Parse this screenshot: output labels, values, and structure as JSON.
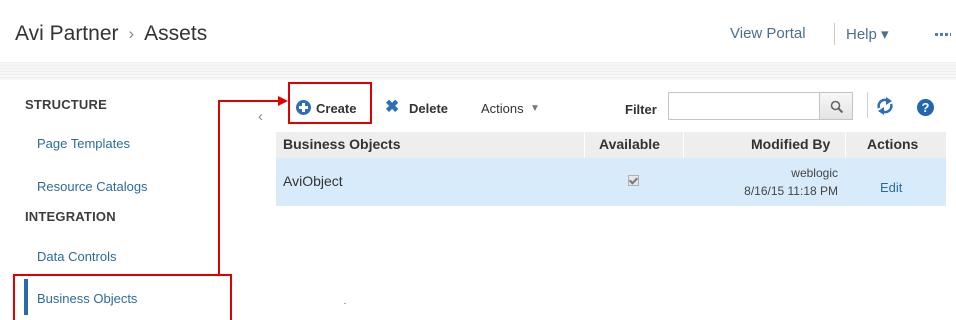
{
  "header": {
    "breadcrumb": {
      "parent": "Avi Partner",
      "separator": "›",
      "current": "Assets"
    },
    "view_portal": "View Portal",
    "help": "Help ▾"
  },
  "sidebar": {
    "sections": [
      {
        "heading": "STRUCTURE",
        "items": [
          "Page Templates",
          "Resource Catalogs"
        ]
      },
      {
        "heading": "INTEGRATION",
        "items": [
          "Data Controls",
          "Business Objects"
        ]
      }
    ],
    "selected_item": "Business Objects"
  },
  "toolbar": {
    "create": "Create",
    "delete": "Delete",
    "actions": "Actions",
    "filter_label": "Filter",
    "filter_value": ""
  },
  "table": {
    "columns": [
      "Business Objects",
      "Available",
      "Modified By",
      "Actions"
    ],
    "rows": [
      {
        "name": "AviObject",
        "available": true,
        "modified_by_user": "weblogic",
        "modified_by_date": "8/16/15 11:18 PM",
        "action": "Edit"
      }
    ]
  },
  "icons": {
    "create": "plus-circle-icon",
    "delete": "x-icon",
    "search": "magnifier-icon",
    "refresh": "refresh-arrows-icon",
    "help": "question-circle-icon"
  },
  "colors": {
    "accent_blue": "#2e6fb7",
    "link_blue": "#2d6b9e",
    "selected_row": "#d7ebfa",
    "annotation_red": "#e00000"
  }
}
